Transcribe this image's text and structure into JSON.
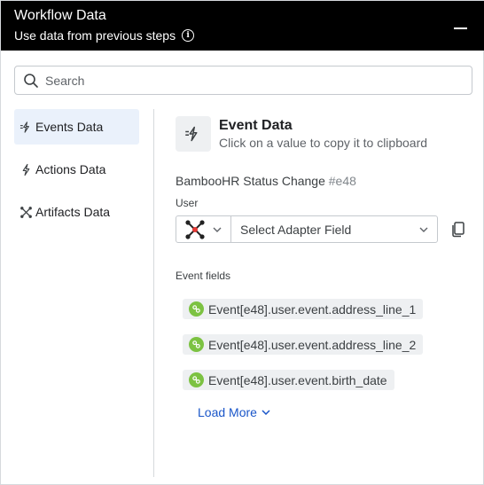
{
  "header": {
    "title": "Workflow Data",
    "subtitle": "Use data from previous steps",
    "info_glyph": "i",
    "info_icon": "info-icon",
    "minimize_icon": "minimize-icon"
  },
  "search": {
    "placeholder": "Search",
    "value": ""
  },
  "nav": {
    "items": [
      {
        "label": "Events Data",
        "icon": "event-icon",
        "active": true
      },
      {
        "label": "Actions Data",
        "icon": "lightning-icon",
        "active": false
      },
      {
        "label": "Artifacts Data",
        "icon": "artifact-icon",
        "active": false
      }
    ]
  },
  "event_data": {
    "title": "Event Data",
    "subtitle": "Click on a value to copy it to clipboard",
    "source_name": "BambooHR Status Change",
    "source_id": "#e48",
    "user_label": "User",
    "adapter_field_placeholder": "Select Adapter Field",
    "event_fields_label": "Event fields",
    "fields": [
      "Event[e48].user.event.address_line_1",
      "Event[e48].user.event.address_line_2",
      "Event[e48].user.event.birth_date"
    ],
    "load_more": "Load More"
  },
  "colors": {
    "header_bg": "#000000",
    "active_nav_bg": "#eaf1fb",
    "chip_bg": "#eef0f2",
    "chip_icon": "#7cc242",
    "link": "#1a56c9",
    "adapter_accent": "#e53935"
  }
}
